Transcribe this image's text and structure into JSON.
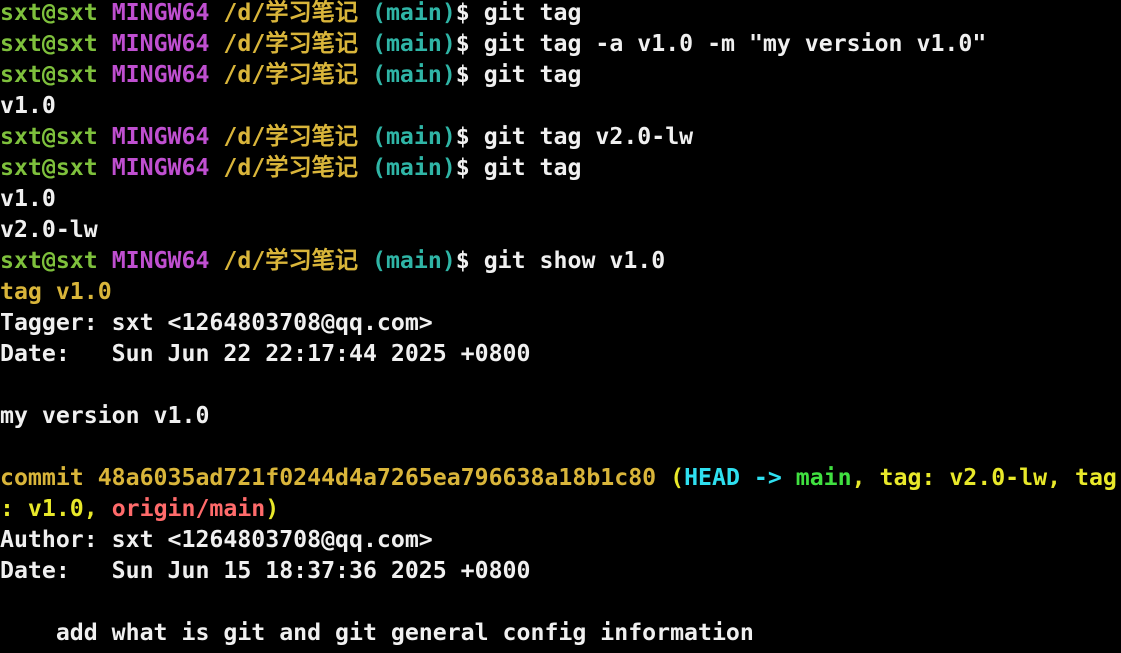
{
  "prompt": {
    "user": "sxt@sxt",
    "system": "MINGW64",
    "path": "/d/学习笔记",
    "branch": "(main)",
    "symbol": "$"
  },
  "lines": [
    {
      "type": "prompt",
      "cmd": "git tag"
    },
    {
      "type": "prompt",
      "cmd": "git tag -a v1.0 -m \"my version v1.0\""
    },
    {
      "type": "prompt",
      "cmd": "git tag"
    },
    {
      "type": "output",
      "text": "v1.0"
    },
    {
      "type": "prompt",
      "cmd": "git tag v2.0-lw"
    },
    {
      "type": "prompt",
      "cmd": "git tag"
    },
    {
      "type": "output",
      "text": "v1.0"
    },
    {
      "type": "output",
      "text": "v2.0-lw"
    },
    {
      "type": "prompt",
      "cmd": "git show v1.0"
    },
    {
      "type": "taghead",
      "text": "tag v1.0"
    },
    {
      "type": "output",
      "text": "Tagger: sxt <1264803708@qq.com>"
    },
    {
      "type": "output",
      "text": "Date:   Sun Jun 22 22:17:44 2025 +0800"
    },
    {
      "type": "output",
      "text": ""
    },
    {
      "type": "output",
      "text": "my version v1.0"
    },
    {
      "type": "output",
      "text": ""
    },
    {
      "type": "commit1"
    },
    {
      "type": "commit2"
    },
    {
      "type": "output",
      "text": "Author: sxt <1264803708@qq.com>"
    },
    {
      "type": "output",
      "text": "Date:   Sun Jun 15 18:37:36 2025 +0800"
    },
    {
      "type": "output",
      "text": ""
    },
    {
      "type": "output",
      "text": "    add what is git and git general config information"
    }
  ],
  "commit": {
    "prefix": "commit 48a6035ad721f0244d4a7265ea796638a18b1c80 ",
    "open": "(",
    "head": "HEAD ->",
    "space": " ",
    "main": "main",
    "comma1": ", ",
    "tag1": "tag: v2.0-lw",
    "comma2": ", ",
    "tag2a": "tag",
    "tag2b": ": v1.0",
    "comma3": ", ",
    "origin": "origin/main",
    "close": ")"
  },
  "colors": {
    "background": "#000000",
    "user": "#7ec03c",
    "system": "#bf4fd0",
    "path": "#d9b53a",
    "branch": "#2fb5a6",
    "text": "#f0f0f0",
    "head": "#2fe0f0",
    "main_ref": "#40e040",
    "tag_ref": "#e8e82a",
    "origin_ref": "#ff6b6b"
  }
}
